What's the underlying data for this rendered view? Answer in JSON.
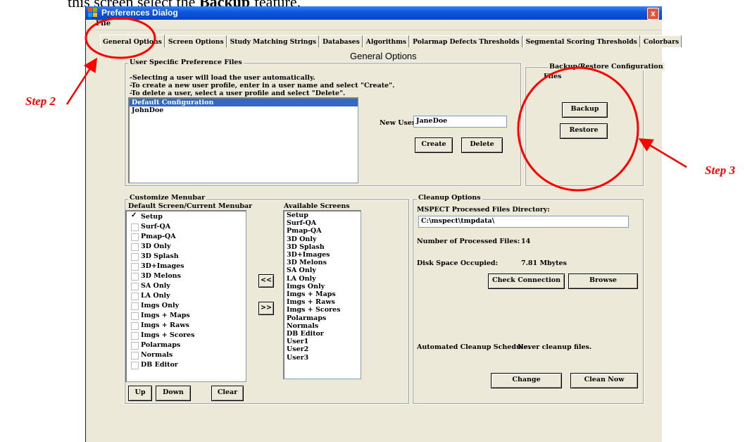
{
  "caption_top": {
    "prefix": "this screen select the",
    "bold": "Backup",
    "suffix": "feature."
  },
  "window": {
    "title": "Preferences Dialog",
    "close_label": "x"
  },
  "menu": {
    "file": "File"
  },
  "tabs": [
    {
      "label": "General Options",
      "active": true
    },
    {
      "label": "Screen Options"
    },
    {
      "label": "Study Matching Strings"
    },
    {
      "label": "Databases"
    },
    {
      "label": "Algorithms"
    },
    {
      "label": "Polarmap Defects Thresholds"
    },
    {
      "label": "Segmental Scoring Thresholds"
    },
    {
      "label": "Colorbars"
    }
  ],
  "heading": "General Options",
  "user_prefs": {
    "legend": "User Specific Preference Files",
    "help": [
      "-Selecting a user will load the user automatically.",
      "-To create a new user profile, enter in a user name and select \"Create\".",
      "-To delete a user, select a user profile and select \"Delete\"."
    ],
    "users": [
      "Default Configuration",
      "JohnDoe"
    ],
    "selected_index": 0,
    "new_user_label": "New User:",
    "new_user_value": "JaneDoe",
    "create_label": "Create",
    "delete_label": "Delete"
  },
  "backup": {
    "legend_line1": "Backup/Restore Configuration",
    "legend_line2": "Files",
    "backup_label": "Backup",
    "restore_label": "Restore"
  },
  "menubar_custom": {
    "legend": "Customize Menubar",
    "left_header": "Default Screen/Current Menubar",
    "right_header": "Available Screens",
    "left_items": [
      {
        "label": "Setup",
        "checked": true
      },
      {
        "label": "Surf-QA"
      },
      {
        "label": "Pmap-QA"
      },
      {
        "label": "3D Only"
      },
      {
        "label": "3D Splash"
      },
      {
        "label": "3D+Images"
      },
      {
        "label": "3D Melons"
      },
      {
        "label": "SA Only"
      },
      {
        "label": "LA Only"
      },
      {
        "label": "Imgs Only"
      },
      {
        "label": "Imgs + Maps"
      },
      {
        "label": "Imgs + Raws"
      },
      {
        "label": "Imgs + Scores"
      },
      {
        "label": "Polarmaps"
      },
      {
        "label": "Normals"
      },
      {
        "label": "DB Editor"
      }
    ],
    "right_items": [
      "Setup",
      "Surf-QA",
      "Pmap-QA",
      "3D Only",
      "3D Splash",
      "3D+Images",
      "3D Melons",
      "SA Only",
      "LA Only",
      "Imgs Only",
      "Imgs + Maps",
      "Imgs + Raws",
      "Imgs + Scores",
      "Polarmaps",
      "Normals",
      "DB Editor",
      "User1",
      "User2",
      "User3"
    ],
    "move_left_label": "<<",
    "move_right_label": ">>",
    "up_label": "Up",
    "down_label": "Down",
    "clear_label": "Clear"
  },
  "cleanup": {
    "legend": "Cleanup Options",
    "dir_label": "MSPECT Processed Files Directory:",
    "dir_value": "C:\\mspect\\tmpdata\\",
    "num_files_label": "Number of Processed Files:",
    "num_files_value": "14",
    "disk_label": "Disk Space Occupied:",
    "disk_value": "7.81 Mbytes",
    "check_connection_label": "Check Connection",
    "browse_label": "Browse",
    "schedule_label": "Automated Cleanup Schedule:",
    "schedule_value": "Never cleanup files.",
    "change_label": "Change",
    "clean_now_label": "Clean Now"
  },
  "annotations": {
    "step2": "Step 2",
    "step3": "Step 3",
    "color": "#ff0000"
  }
}
